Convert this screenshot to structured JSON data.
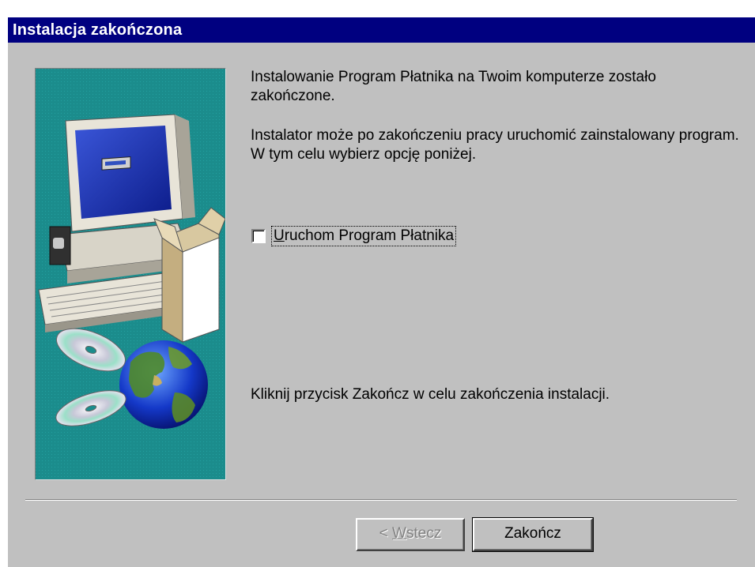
{
  "window": {
    "title": "Instalacja zakończona"
  },
  "content": {
    "paragraph_1": "Instalowanie Program Płatnika na Twoim komputerze zostało zakończone.",
    "paragraph_2": "Instalator może po zakończeniu pracy uruchomić zainstalowany program. W tym celu wybierz opcję poniżej.",
    "launch_checkbox": {
      "label_mnemonic": "U",
      "label_rest": "ruchom Program Płatnika",
      "checked": false
    },
    "paragraph_3": "Kliknij przycisk Zakończ w celu zakończenia instalacji."
  },
  "buttons": {
    "back_prefix": "< ",
    "back_mnemonic": "W",
    "back_rest": "stecz",
    "back_enabled": false,
    "finish_label": "Zakończ"
  },
  "colors": {
    "titlebar": "#000080",
    "dialog_bg": "#c0c0c0",
    "art_bg": "#1b8c8c"
  },
  "icons": [
    "computer-illustration",
    "globe-icon",
    "cd-disc-icon",
    "box-icon"
  ]
}
